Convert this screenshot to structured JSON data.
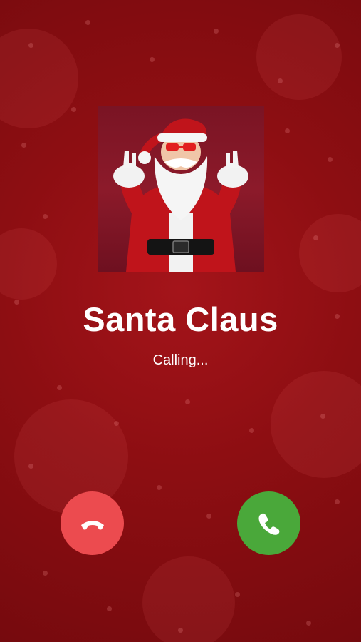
{
  "caller": {
    "name": "Santa Claus",
    "status": "Calling...",
    "avatar_alt": "Santa Claus"
  },
  "actions": {
    "decline_icon": "phone-hangup-icon",
    "accept_icon": "phone-icon"
  },
  "colors": {
    "background": "#8a0c10",
    "decline": "#ec4b4f",
    "accept": "#4aa83a",
    "text": "#ffffff"
  }
}
